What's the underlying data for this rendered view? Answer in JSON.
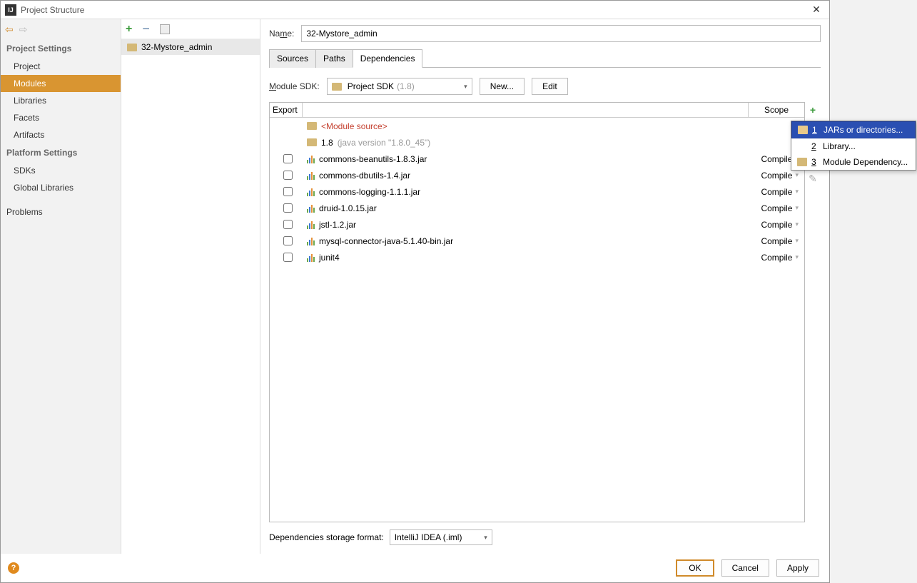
{
  "window": {
    "title": "Project Structure"
  },
  "sidebar": {
    "sections": [
      {
        "title": "Project Settings",
        "items": [
          "Project",
          "Modules",
          "Libraries",
          "Facets",
          "Artifacts"
        ]
      },
      {
        "title": "Platform Settings",
        "items": [
          "SDKs",
          "Global Libraries"
        ]
      },
      {
        "title": "",
        "items": [
          "Problems"
        ]
      }
    ],
    "selected": "Modules"
  },
  "modulesList": {
    "items": [
      "32-Mystore_admin"
    ]
  },
  "namePanel": {
    "label": "Name:",
    "value": "32-Mystore_admin"
  },
  "tabs": {
    "items": [
      "Sources",
      "Paths",
      "Dependencies"
    ],
    "active": "Dependencies"
  },
  "sdk": {
    "label": "Module SDK:",
    "value_main": "Project SDK",
    "value_sub": "(1.8)",
    "new_btn": "New...",
    "edit_btn": "Edit"
  },
  "depsTable": {
    "headers": {
      "export": "Export",
      "scope": "Scope"
    },
    "moduleSource": "<Module source>",
    "sdkRow": {
      "name": "1.8",
      "sub": "(java version \"1.8.0_45\")"
    },
    "rows": [
      {
        "name": "commons-beanutils-1.8.3.jar",
        "scope": "Compile"
      },
      {
        "name": "commons-dbutils-1.4.jar",
        "scope": "Compile"
      },
      {
        "name": "commons-logging-1.1.1.jar",
        "scope": "Compile"
      },
      {
        "name": "druid-1.0.15.jar",
        "scope": "Compile"
      },
      {
        "name": "jstl-1.2.jar",
        "scope": "Compile"
      },
      {
        "name": "mysql-connector-java-5.1.40-bin.jar",
        "scope": "Compile"
      },
      {
        "name": "junit4",
        "scope": "Compile"
      }
    ]
  },
  "storage": {
    "label": "Dependencies storage format:",
    "value": "IntelliJ IDEA (.iml)"
  },
  "footer": {
    "ok": "OK",
    "cancel": "Cancel",
    "apply": "Apply"
  },
  "popup": {
    "items": [
      {
        "num": "1",
        "label": "JARs or directories...",
        "icon": "folder"
      },
      {
        "num": "2",
        "label": "Library...",
        "icon": "bars"
      },
      {
        "num": "3",
        "label": "Module Dependency...",
        "icon": "folder"
      }
    ],
    "selected": 0
  }
}
